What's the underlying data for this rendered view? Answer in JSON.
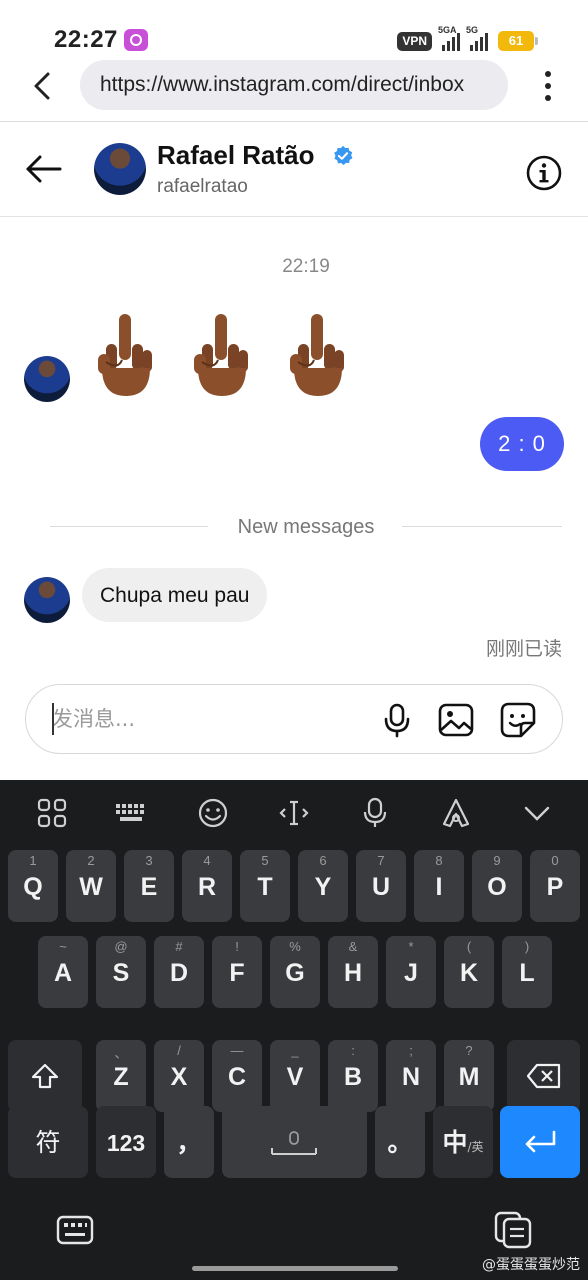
{
  "status_bar": {
    "time": "22:27",
    "vpn": "VPN",
    "network1": "5GA",
    "network2": "5G",
    "battery": "61"
  },
  "browser": {
    "url": "https://www.instagram.com/direct/inbox"
  },
  "chat": {
    "name": "Rafael Ratão",
    "username": "rafaelratao",
    "timestamp": "22:19",
    "emoji_count": 3,
    "outgoing_message": "2 : 0",
    "new_messages_label": "New messages",
    "incoming_message": "Chupa meu pau",
    "read_receipt": "刚刚已读"
  },
  "composer": {
    "placeholder": "发消息..."
  },
  "keyboard": {
    "row1": [
      {
        "main": "Q",
        "sub": "1"
      },
      {
        "main": "W",
        "sub": "2"
      },
      {
        "main": "E",
        "sub": "3"
      },
      {
        "main": "R",
        "sub": "4"
      },
      {
        "main": "T",
        "sub": "5"
      },
      {
        "main": "Y",
        "sub": "6"
      },
      {
        "main": "U",
        "sub": "7"
      },
      {
        "main": "I",
        "sub": "8"
      },
      {
        "main": "O",
        "sub": "9"
      },
      {
        "main": "P",
        "sub": "0"
      }
    ],
    "row2": [
      {
        "main": "A",
        "sub": "~"
      },
      {
        "main": "S",
        "sub": "@"
      },
      {
        "main": "D",
        "sub": "#"
      },
      {
        "main": "F",
        "sub": "!"
      },
      {
        "main": "G",
        "sub": "%"
      },
      {
        "main": "H",
        "sub": "&"
      },
      {
        "main": "J",
        "sub": "*"
      },
      {
        "main": "K",
        "sub": "("
      },
      {
        "main": "L",
        "sub": ")"
      }
    ],
    "row3": [
      {
        "main": "Z",
        "sub": "、"
      },
      {
        "main": "X",
        "sub": "/"
      },
      {
        "main": "C",
        "sub": "—"
      },
      {
        "main": "V",
        "sub": "_"
      },
      {
        "main": "B",
        "sub": ":"
      },
      {
        "main": "N",
        "sub": ";"
      },
      {
        "main": "M",
        "sub": "?"
      }
    ],
    "symbol_key": "符",
    "number_key": "123",
    "comma_key": "，",
    "period_key": "。",
    "lang_key": "中",
    "lang_sub": "/英"
  },
  "watermark": "@蛋蛋蛋蛋炒范",
  "colors": {
    "accent": "#4c5bf4",
    "verified": "#3897f0",
    "enter_key": "#1e88ff",
    "battery": "#f2b80c"
  }
}
